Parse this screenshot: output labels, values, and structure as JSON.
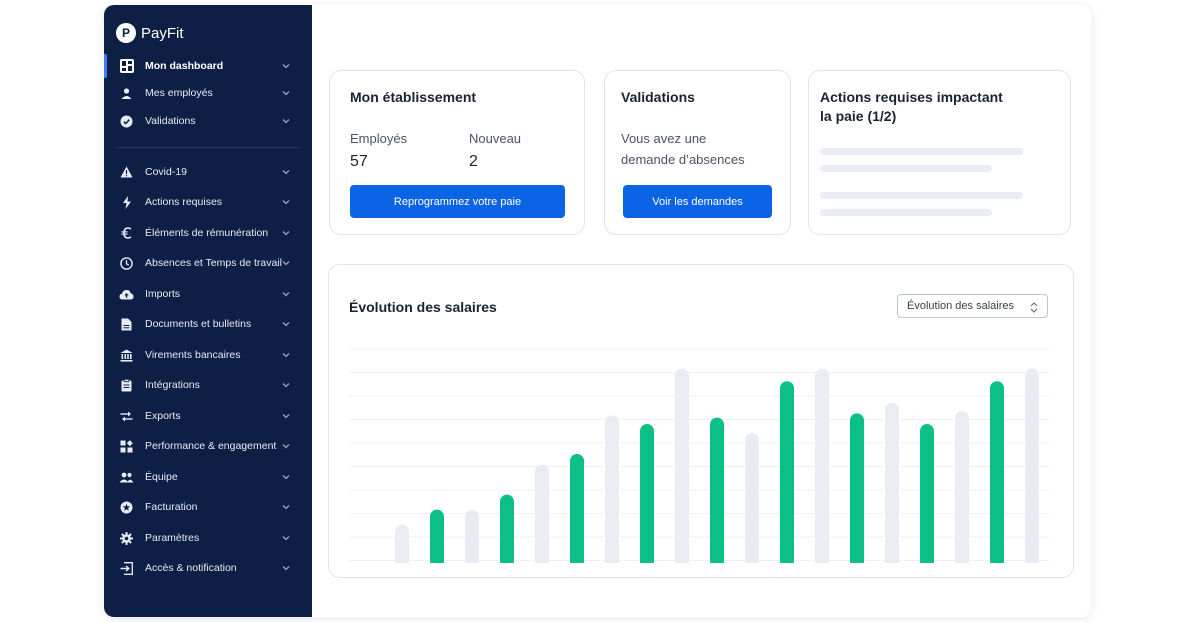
{
  "brand": {
    "name": "PayFit",
    "logo_letter": "P"
  },
  "sidebar": {
    "items": [
      {
        "label": "Mon dashboard",
        "icon": "dashboard-icon",
        "active": true
      },
      {
        "label": "Mes employés",
        "icon": "person-icon"
      },
      {
        "label": "Validations",
        "icon": "check-circle-icon"
      },
      {
        "label": "Covid-19",
        "icon": "warning-icon"
      },
      {
        "label": "Actions requises",
        "icon": "bolt-icon"
      },
      {
        "label": "Éléments de rémunération",
        "icon": "euro-icon"
      },
      {
        "label": "Absences et Temps de travail",
        "icon": "clock-icon"
      },
      {
        "label": "Imports",
        "icon": "cloud-upload-icon"
      },
      {
        "label": "Documents et bulletins",
        "icon": "document-icon"
      },
      {
        "label": "Virements bancaires",
        "icon": "bank-icon"
      },
      {
        "label": "Intégrations",
        "icon": "clipboard-icon"
      },
      {
        "label": "Exports",
        "icon": "swap-icon"
      },
      {
        "label": "Performance & engagement",
        "icon": "widgets-icon"
      },
      {
        "label": "Équipe",
        "icon": "people-icon"
      },
      {
        "label": "Facturation",
        "icon": "star-circle-icon"
      },
      {
        "label": "Paramètres",
        "icon": "gear-icon"
      },
      {
        "label": "Accès & notification",
        "icon": "login-icon"
      }
    ]
  },
  "etablissement": {
    "title": "Mon établissement",
    "employes_label": "Employés",
    "employes_value": "57",
    "nouveau_label": "Nouveau",
    "nouveau_value": "2",
    "button_label": "Reprogrammez votre paie"
  },
  "validations": {
    "title": "Validations",
    "text_line1": "Vous avez une",
    "text_line2": "demande d’absences",
    "button_label": "Voir les demandes"
  },
  "actions": {
    "title_line1": "Actions requises impactant",
    "title_line2": "la paie (1/2)"
  },
  "salaires": {
    "title": "Évolution des salaires",
    "select_value": "Évolution des salaires"
  },
  "colors": {
    "sidebar_bg": "#0e1f45",
    "accent_blue": "#0b63e5",
    "bar_green": "#0bbf86",
    "bar_grey": "#e9edf3"
  },
  "chart_data": {
    "type": "bar",
    "ylim": [
      0,
      100
    ],
    "grid": true,
    "series": [
      {
        "values": [
          17,
          24,
          45,
          68,
          90,
          60,
          90,
          74,
          70,
          90
        ]
      },
      {
        "values": [
          24,
          31,
          50,
          64,
          67,
          84,
          69,
          64,
          84
        ]
      }
    ]
  }
}
